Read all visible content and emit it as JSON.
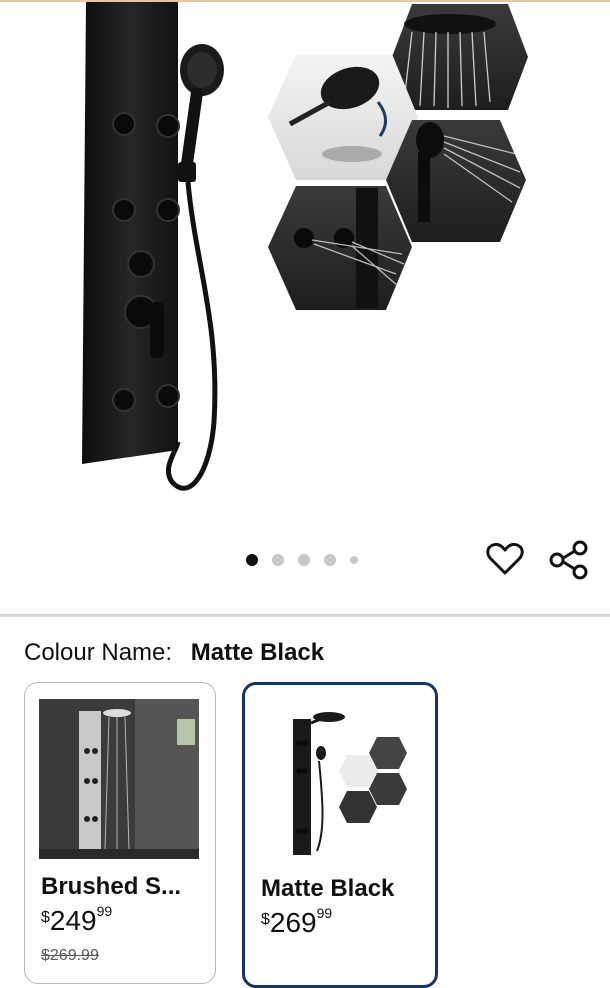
{
  "gallery": {
    "total_images": 5,
    "active_index": 0
  },
  "actions": {
    "wishlist_icon": "heart-outline",
    "share_icon": "share-nodes"
  },
  "variation": {
    "label": "Colour Name:",
    "selected_value": "Matte Black"
  },
  "options": [
    {
      "name": "Brushed S...",
      "currency": "$",
      "price_whole": "249",
      "price_fraction": "99",
      "list_price": "$269.99",
      "selected": false
    },
    {
      "name": "Matte Black",
      "currency": "$",
      "price_whole": "269",
      "price_fraction": "99",
      "selected": true
    }
  ],
  "colors": {
    "selected_border": "#16365f",
    "product_black": "#1a1a1a"
  }
}
